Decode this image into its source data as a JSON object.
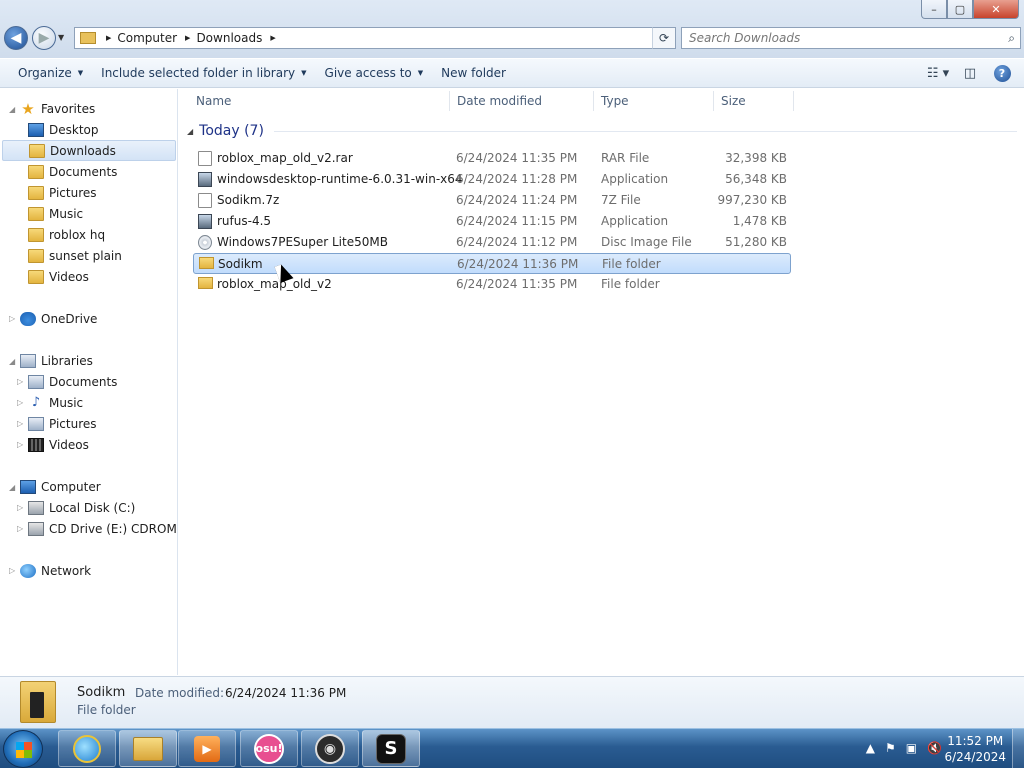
{
  "window": {
    "min_glyph": "–",
    "max_glyph": "▢",
    "close_glyph": "✕"
  },
  "address": {
    "segments": [
      "Computer",
      "Downloads"
    ]
  },
  "search": {
    "placeholder": "Search Downloads"
  },
  "toolbar": {
    "organize": "Organize",
    "include": "Include selected folder in library",
    "give_access": "Give access to",
    "new_folder": "New folder"
  },
  "columns": {
    "name": "Name",
    "date": "Date modified",
    "type": "Type",
    "size": "Size"
  },
  "nav": {
    "favorites": "Favorites",
    "desktop": "Desktop",
    "downloads": "Downloads",
    "documents": "Documents",
    "pictures": "Pictures",
    "music": "Music",
    "roblox_hq": "roblox hq",
    "sunset_plain": "sunset plain",
    "videos": "Videos",
    "onedrive": "OneDrive",
    "libraries": "Libraries",
    "lib_documents": "Documents",
    "lib_music": "Music",
    "lib_pictures": "Pictures",
    "lib_videos": "Videos",
    "computer": "Computer",
    "local_disk": "Local Disk (C:)",
    "cd_drive": "CD Drive (E:) CDROM",
    "network": "Network"
  },
  "group": {
    "label": "Today (7)"
  },
  "files": [
    {
      "name": "roblox_map_old_v2.rar",
      "date": "6/24/2024 11:35 PM",
      "type": "RAR File",
      "size": "32,398 KB",
      "icon": "document-icon"
    },
    {
      "name": "windowsdesktop-runtime-6.0.31-win-x64",
      "date": "6/24/2024 11:28 PM",
      "type": "Application",
      "size": "56,348 KB",
      "icon": "installer-icon"
    },
    {
      "name": "Sodikm.7z",
      "date": "6/24/2024 11:24 PM",
      "type": "7Z File",
      "size": "997,230 KB",
      "icon": "document-icon"
    },
    {
      "name": "rufus-4.5",
      "date": "6/24/2024 11:15 PM",
      "type": "Application",
      "size": "1,478 KB",
      "icon": "usb-app-icon"
    },
    {
      "name": "Windows7PESuper Lite50MB",
      "date": "6/24/2024 11:12 PM",
      "type": "Disc Image File",
      "size": "51,280 KB",
      "icon": "disc-image-icon"
    },
    {
      "name": "Sodikm",
      "date": "6/24/2024 11:36 PM",
      "type": "File folder",
      "size": "",
      "icon": "folder-icon",
      "selected": true
    },
    {
      "name": "roblox_map_old_v2",
      "date": "6/24/2024 11:35 PM",
      "type": "File folder",
      "size": "",
      "icon": "folder-icon"
    }
  ],
  "details": {
    "name": "Sodikm",
    "modified_label": "Date modified:",
    "modified_value": "6/24/2024 11:36 PM",
    "type": "File folder"
  },
  "taskbar": {
    "osu_label": "osu!",
    "s_label": "S"
  },
  "clock": {
    "time": "11:52 PM",
    "date": "6/24/2024"
  }
}
